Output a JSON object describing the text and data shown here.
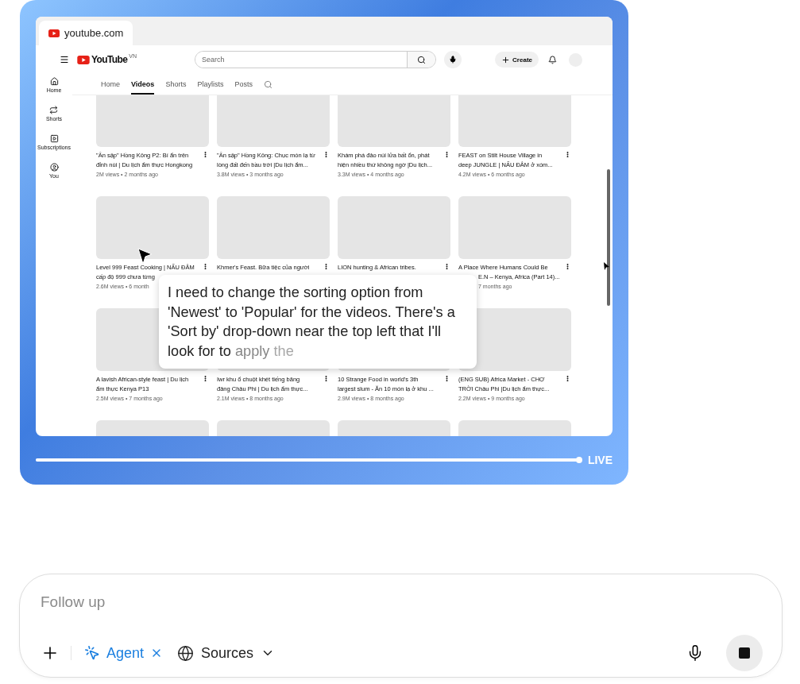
{
  "browser": {
    "tab": "youtube.com"
  },
  "youtube": {
    "logo": "YouTube",
    "region": "VN",
    "search": {
      "placeholder": "Search"
    },
    "create": "Create",
    "sidebar": [
      {
        "label": "Home",
        "kind": "home"
      },
      {
        "label": "Shorts",
        "kind": "shorts"
      },
      {
        "label": "Subscriptions",
        "kind": "subscriptions"
      },
      {
        "label": "You",
        "kind": "you"
      }
    ],
    "tabs": [
      {
        "label": "Home",
        "selected": false
      },
      {
        "label": "Videos",
        "selected": true
      },
      {
        "label": "Shorts",
        "selected": false
      },
      {
        "label": "Playlists",
        "selected": false
      },
      {
        "label": "Posts",
        "selected": false
      }
    ],
    "rows": [
      {
        "cards": [
          {
            "kind": "video",
            "lines": [
              "\"Ẩn sập\" Hồng Kông P2: Bí ẩn trên",
              "đỉnh núi | Du lịch ẩm thực Hongkong"
            ],
            "meta": "2M views • 2 months ago",
            "partly_hidden": false
          },
          {
            "kind": "video",
            "lines": [
              "\"Ẩn sập\" Hồng Kông: Chục món lạ từ",
              "lòng đất đến bầu trời |Du lịch ẩm..."
            ],
            "meta": "3.8M views • 3 months ago",
            "partly_hidden": false
          },
          {
            "kind": "video",
            "lines": [
              "Khám phá đảo núi lửa bất ổn, phát",
              "hiện nhiều thứ không ngờ |Du lịch..."
            ],
            "meta": "3.3M views • 4 months ago",
            "partly_hidden": false
          },
          {
            "kind": "video",
            "lines": [
              "FEAST on Stilt House Village in",
              "deep JUNGLE | NẤU ĐÂM ở xóm..."
            ],
            "meta": "4.2M views • 6 months ago",
            "partly_hidden": false
          }
        ]
      },
      {
        "cards": [
          {
            "kind": "video",
            "lines": [
              "Level 999 Feast Cooking | NẤU ĐÂM",
              "cấp độ 999 chưa từng"
            ],
            "meta": "2.6M views • 6 month",
            "partly_hidden": false
          },
          {
            "kind": "video",
            "lines": [
              "Khmer's Feast. Bữa tiệc của người"
            ]
          },
          {
            "kind": "video",
            "lines": [
              "LION hunting & African tribes."
            ]
          },
          {
            "kind": "video",
            "lines": [
              "A Place Where Humans Could Be",
              "E.N – Kenya, Africa (Part 14)..."
            ],
            "meta": "7 months ago",
            "partly_hidden": true
          }
        ]
      },
      {
        "cards": [
          {
            "kind": "video",
            "lines": [
              "A lavish African-style feast | Du lịch",
              "ẩm thực Kenya P13"
            ],
            "meta": "2.5M views • 7 months ago",
            "partly_hidden": false
          },
          {
            "kind": "video",
            "lines": [
              "Iwr khu ổ chuột khét tiếng băng",
              "đảng Châu Phi | Du lịch ẩm thực..."
            ],
            "meta": "2.1M views • 8 months ago",
            "partly_hidden": false
          },
          {
            "kind": "video",
            "lines": [
              "10 Strange Food in world's 3th",
              "largest slum - Ăn 10 món lạ ở khu ..."
            ],
            "meta": "2.9M views • 8 months ago",
            "partly_hidden": false
          },
          {
            "kind": "video",
            "lines": [
              "(ENG SUB) Africa Market - CHỢ",
              "TRỜI Châu Phi |Du lịch ẩm thực..."
            ],
            "meta": "2.2M views • 9 months ago",
            "partly_hidden": false
          }
        ]
      },
      {
        "cards": [
          {
            "kind": "placeholder"
          },
          {
            "kind": "placeholder"
          },
          {
            "kind": "placeholder"
          },
          {
            "kind": "placeholder"
          }
        ]
      }
    ]
  },
  "overlay": {
    "text": "I need to change the sorting option from 'Newest' to 'Popular' for the videos. There's a 'Sort by' drop-down near the top left that I'll look for to",
    "faded": [
      "apply",
      "the"
    ]
  },
  "player": {
    "level": 1,
    "live": "LIVE"
  },
  "composer": {
    "placeholder": "Follow up",
    "mode": "Agent",
    "sources": "Sources"
  }
}
